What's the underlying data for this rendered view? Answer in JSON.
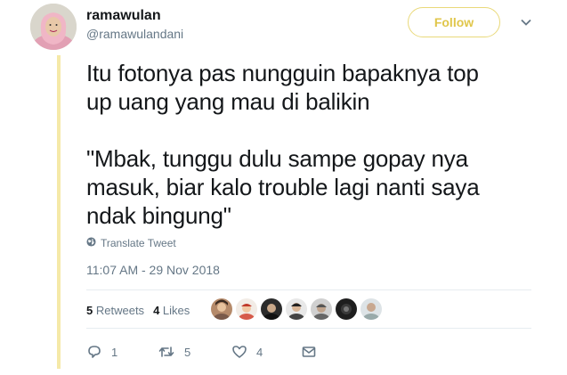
{
  "user": {
    "name": "ramawulan",
    "handle": "@ramawulandani"
  },
  "follow_label": "Follow",
  "tweet": {
    "text": "Itu fotonya pas nungguin bapaknya top\nup uang yang mau di balikin\n\n\"Mbak, tunggu dulu sampe gopay nya\nmasuk, biar kalo trouble lagi nanti saya\nndak bingung\""
  },
  "translate_label": "Translate Tweet",
  "timestamp": "11:07 AM - 29 Nov 2018",
  "stats": {
    "retweets_count": "5",
    "retweets_label": "Retweets",
    "likes_count": "4",
    "likes_label": "Likes"
  },
  "actions": {
    "reply_count": "1",
    "retweet_count": "5",
    "like_count": "4"
  },
  "colors": {
    "accent": "#e0c64a",
    "thread_line": "#f5e9a8",
    "muted": "#657786"
  }
}
